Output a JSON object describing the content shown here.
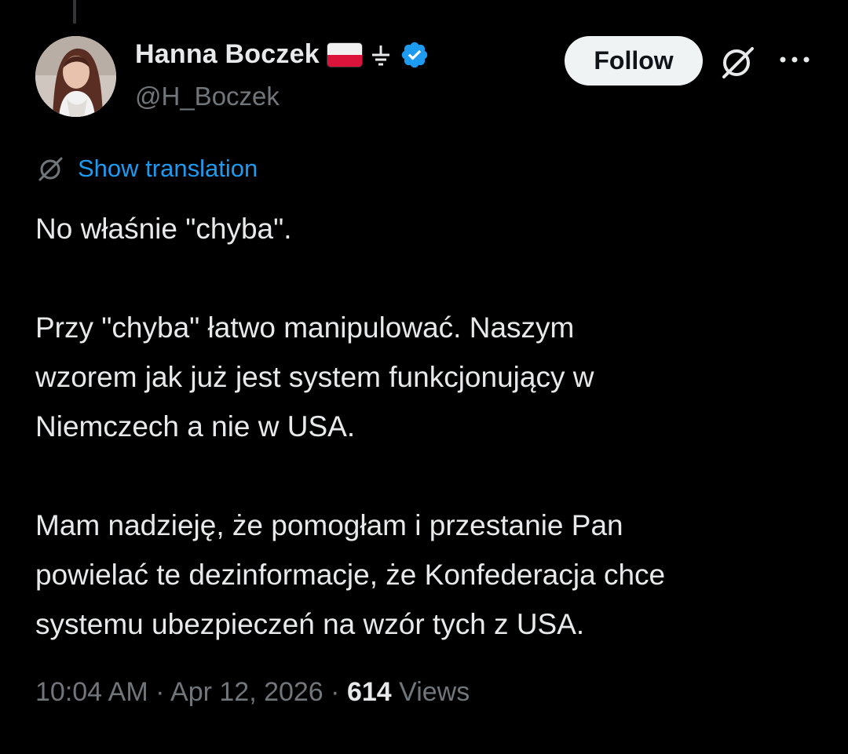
{
  "author": {
    "display_name": "Hanna Boczek",
    "handle": "@H_Boczek",
    "flag": "poland-flag",
    "extra_icon": "ground-symbol-icon",
    "verified_icon": "verified-badge-icon",
    "verified_color": "#1d9bf0"
  },
  "actions": {
    "follow_label": "Follow",
    "grok_icon": "grok-icon",
    "more_icon": "more-icon"
  },
  "translation": {
    "icon": "grok-translate-icon",
    "label": "Show translation",
    "color": "#1d9bf0"
  },
  "tweet": {
    "paragraphs": [
      [
        "No właśnie \"chyba\"."
      ],
      [
        "Przy \"chyba\" łatwo manipulować. Naszym",
        "wzorem jak już jest system funkcjonujący w",
        "Niemczech a nie w USA."
      ],
      [
        "Mam nadzieję, że pomogłam i przestanie Pan",
        "powielać te dezinformacje, że Konfederacja chce",
        "systemu ubezpieczeń na wzór tych z USA."
      ]
    ]
  },
  "meta": {
    "time": "10:04 AM",
    "separator": "·",
    "date": "Apr 12, 2026",
    "views_count": "614",
    "views_label": "Views"
  },
  "colors": {
    "background": "#000000",
    "text_primary": "#e7e9ea",
    "text_secondary": "#71767b",
    "accent": "#1d9bf0"
  }
}
